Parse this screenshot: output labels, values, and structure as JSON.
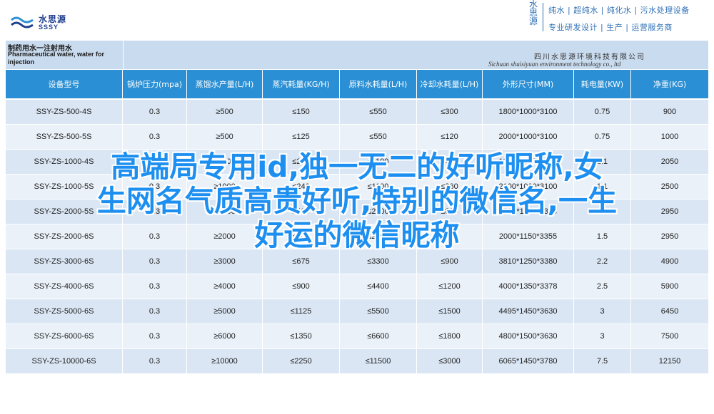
{
  "banner": {
    "logo_cn": "水思源",
    "logo_en": "SSSY",
    "vertical_text": "水思源",
    "slogan_line1": "纯水 | 超纯水 | 纯化水 | 污水处理设备",
    "slogan_line2": "专业研发设计 | 生产 | 运营服务商"
  },
  "doc": {
    "title_cn": "制药用水一注射用水",
    "title_en": "Pharmaceutical water, water for injection",
    "company_cn": "四川水思源环境科技有限公司",
    "company_en": "Sichuan shuisiyuan environment technology co., ltd"
  },
  "table": {
    "headers": [
      "设备型号",
      "锅炉压力(mpa)",
      "蒸馏水产量(L/H)",
      "蒸汽耗量(KG/H)",
      "原料水耗量(L/H)",
      "冷却水耗量(L/H)",
      "外形尺寸(MM)",
      "耗电量(KW)",
      "净重(KG)"
    ],
    "rows": [
      [
        "SSY-ZS-500-4S",
        "0.3",
        "≥500",
        "≤150",
        "≤550",
        "≤300",
        "1800*1000*3100",
        "0.75",
        "900"
      ],
      [
        "SSY-ZS-500-5S",
        "0.3",
        "≥500",
        "≤125",
        "≤550",
        "≤120",
        "2000*1000*3100",
        "0.75",
        "1000"
      ],
      [
        "SSY-ZS-1000-4S",
        "0.3",
        "≥1000",
        "≤250",
        "≤1100",
        "≤450",
        "1900*1000*3100",
        "1.1",
        "2050"
      ],
      [
        "SSY-ZS-1000-5S",
        "0.3",
        "≥1000",
        "≤240",
        "≤1100",
        "≤360",
        "2100*1000*3100",
        "1.1",
        "2500"
      ],
      [
        "SSY-ZS-2000-5S",
        "0.3",
        "≥2000",
        "≤480",
        "≤2200",
        "≤800",
        "2000*1150*3355",
        "1.5",
        "2950"
      ],
      [
        "SSY-ZS-2000-6S",
        "0.3",
        "≥2000",
        "≤400",
        "≤2200",
        "≤600",
        "2000*1150*3355",
        "1.5",
        "2950"
      ],
      [
        "SSY-ZS-3000-6S",
        "0.3",
        "≥3000",
        "≤675",
        "≤3300",
        "≤900",
        "3810*1250*3380",
        "2.2",
        "4900"
      ],
      [
        "SSY-ZS-4000-6S",
        "0.3",
        "≥4000",
        "≤900",
        "≤4400",
        "≤1200",
        "4000*1350*3378",
        "2.5",
        "5900"
      ],
      [
        "SSY-ZS-5000-6S",
        "0.3",
        "≥5000",
        "≤1125",
        "≤5500",
        "≤1500",
        "4495*1450*3630",
        "3",
        "6450"
      ],
      [
        "SSY-ZS-6000-6S",
        "0.3",
        "≥6000",
        "≤1350",
        "≤6600",
        "≤1800",
        "4800*1500*3630",
        "3",
        "7500"
      ],
      [
        "SSY-ZS-10000-6S",
        "0.3",
        "≥10000",
        "≤2250",
        "≤11500",
        "≤3000",
        "6065*1450*3780",
        "7.5",
        "12150"
      ]
    ]
  },
  "overlay": {
    "line1": "高端局专用id,独一无二的好听昵称,女",
    "line2": "生网名气质高贵好听,特别的微信名,一生",
    "line3": "好运的微信昵称"
  },
  "colors": {
    "header_blue": "#2a8fd4",
    "brand_blue": "#1f3f8f",
    "overlay_blue": "#1d8ff0",
    "row_light": "#dae6f4"
  }
}
